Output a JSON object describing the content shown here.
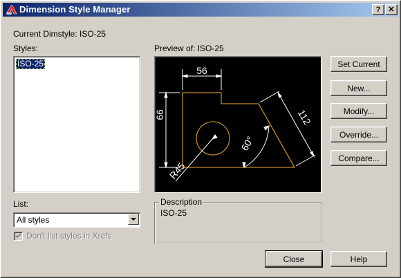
{
  "window": {
    "title": "Dimension Style Manager",
    "help_glyph": "?",
    "close_glyph": "✕"
  },
  "current_dimstyle": {
    "label": "Current Dimstyle:",
    "value": "ISO-25"
  },
  "styles": {
    "label": "Styles:",
    "items": [
      "ISO-25"
    ]
  },
  "preview": {
    "label": "Preview of:",
    "value": "ISO-25",
    "dimensions": {
      "horizontal": "56",
      "vertical": "66",
      "aligned": "112",
      "angular": "60°",
      "radius": "R45"
    },
    "colors": {
      "geometry": "#c08a2a",
      "dimension": "#ffffff",
      "background": "#000000"
    }
  },
  "list": {
    "label": "List:",
    "selected": "All styles"
  },
  "xrefs_checkbox": {
    "label": "Don't list styles in Xrefs",
    "checked": true,
    "enabled": false
  },
  "description": {
    "label": "Description",
    "text": "ISO-25"
  },
  "buttons": {
    "set_current": "Set Current",
    "new": "New...",
    "modify": "Modify...",
    "override": "Override...",
    "compare": "Compare...",
    "close": "Close",
    "help": "Help"
  },
  "icons": {
    "app": "autocad-app-icon",
    "combo_arrow": "chevron-down-icon",
    "checkmark": "checkmark-icon"
  }
}
